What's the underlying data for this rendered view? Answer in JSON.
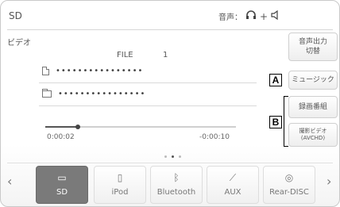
{
  "header": {
    "source": "SD",
    "audio_label": "音声：",
    "audio_icons": [
      "headphones-icon",
      "speaker-icon"
    ],
    "audio_plus": "+"
  },
  "content": {
    "category": "ビデオ",
    "file_label": "FILE",
    "file_number": "1",
    "track_title": "••••••••••••••••",
    "folder_name": "••••••••••••••••",
    "time_elapsed": "0:00:02",
    "time_remaining": "-0:00:10",
    "progress_fraction": 0.17
  },
  "side_buttons": {
    "output": "音声出力\n切替",
    "music": "ミュージック",
    "record": "録画番組",
    "avchd": "撮影ビデオ\n(AVCHD)"
  },
  "callouts": {
    "a": "A",
    "b": "B"
  },
  "sources": [
    {
      "label": "SD",
      "icon": "sd-card-icon",
      "glyph": "▭",
      "active": true
    },
    {
      "label": "iPod",
      "icon": "ipod-icon",
      "glyph": "▯",
      "active": false
    },
    {
      "label": "Bluetooth",
      "icon": "bluetooth-icon",
      "glyph": "ᛒ",
      "active": false
    },
    {
      "label": "AUX",
      "icon": "aux-cable-icon",
      "glyph": "⟋",
      "active": false
    },
    {
      "label": "Rear-DISC",
      "icon": "disc-icon",
      "glyph": "◎",
      "active": false
    }
  ],
  "nav": {
    "left": "‹",
    "right": "›"
  },
  "pager": {
    "count": 3,
    "active_index": 1
  },
  "colors": {
    "active_source_bg": "#7a7a7a",
    "border": "#c9c9c9"
  }
}
